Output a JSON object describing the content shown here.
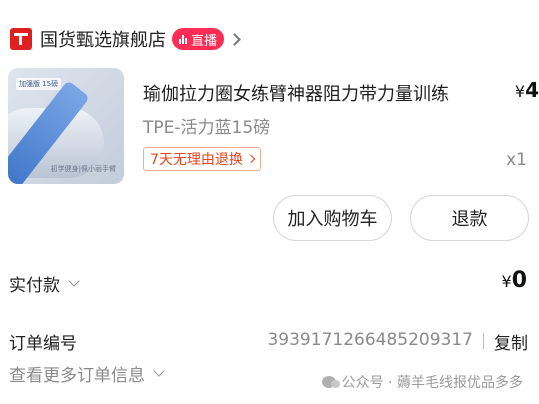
{
  "shop": {
    "name": "国货甄选旗舰店",
    "live_label": "直播"
  },
  "product": {
    "title": "瑜伽拉力圈女练臂神器阻力带力量训练",
    "price_currency": "¥",
    "price_value": "4",
    "spec": "TPE-活力蓝15磅",
    "return_policy": "7天无理由退换",
    "quantity": "x1",
    "image": {
      "tag": "加强版 15磅",
      "caption": "初学健身|佩小丽手臂"
    }
  },
  "actions": {
    "add_to_cart": "加入购物车",
    "refund": "退款"
  },
  "payment": {
    "label": "实付款",
    "currency": "¥",
    "amount": "0"
  },
  "order": {
    "number_label": "订单编号",
    "number": "3939171266485209317",
    "copy_label": "复制",
    "more_info": "查看更多订单信息"
  },
  "watermark": "公众号 · 薅羊毛线报优品多多"
}
